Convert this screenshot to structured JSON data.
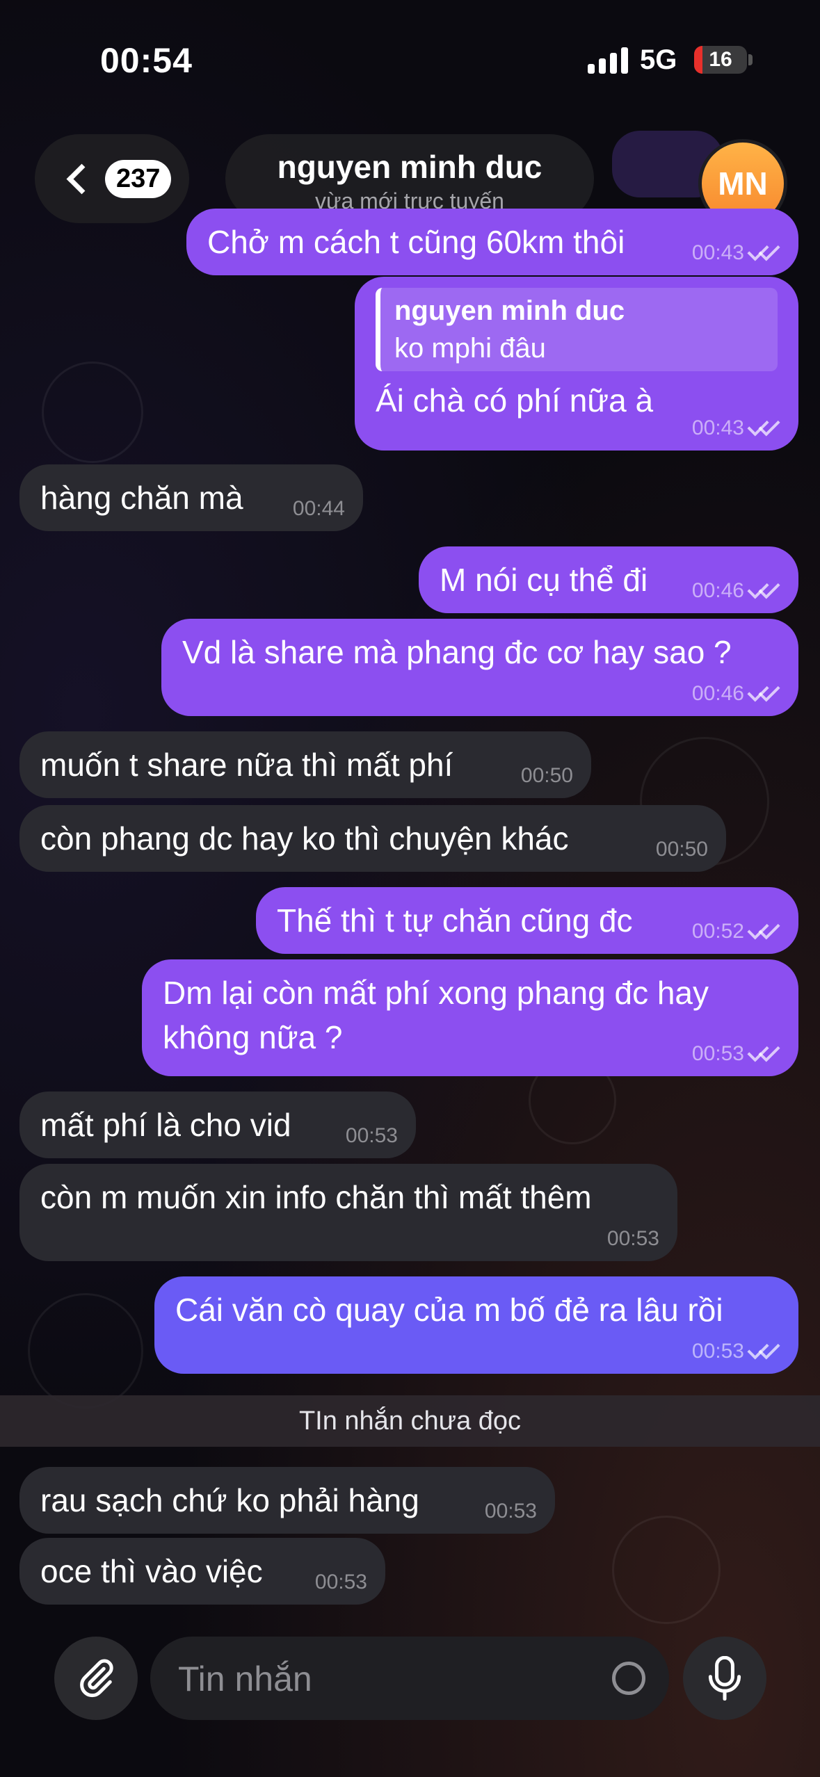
{
  "status_bar": {
    "time": "00:54",
    "network": "5G",
    "battery": "16",
    "battery_level": 0.16
  },
  "header": {
    "unread_count": "237",
    "contact_name": "nguyen minh duc",
    "contact_status": "vừa mới trực tuyến",
    "avatar_initials": "MN"
  },
  "messages": [
    {
      "dir": "out",
      "text": "Chở m cách t cũng 60km thôi",
      "time": "00:43"
    },
    {
      "dir": "out",
      "reply_name": "nguyen minh duc",
      "reply_text": "ko mphi đâu",
      "text": "Ái chà có phí nữa à",
      "time": "00:43"
    },
    {
      "dir": "in",
      "text": "hàng chăn mà",
      "time": "00:44"
    },
    {
      "dir": "out",
      "text": "M nói cụ thể đi",
      "time": "00:46"
    },
    {
      "dir": "out",
      "text": "Vd là share mà phang đc cơ hay sao ?",
      "time": "00:46"
    },
    {
      "dir": "in",
      "text": "muốn t share nữa thì mất phí",
      "time": "00:50"
    },
    {
      "dir": "in",
      "text": "còn phang dc hay ko thì chuyện khác",
      "time": "00:50"
    },
    {
      "dir": "out",
      "text": "Thế thì t tự chăn cũng đc",
      "time": "00:52"
    },
    {
      "dir": "out",
      "text": "Dm lại còn mất phí xong phang đc hay không nữa ?",
      "time": "00:53"
    },
    {
      "dir": "in",
      "text": "mất phí là cho vid",
      "time": "00:53"
    },
    {
      "dir": "in",
      "text": "còn m muốn xin info chăn thì mất thêm",
      "time": "00:53"
    },
    {
      "dir": "out",
      "text": "Cái văn cò quay của m bố đẻ ra lâu rồi",
      "time": "00:53"
    },
    {
      "dir": "in",
      "text": "rau sạch chứ ko phải hàng",
      "time": "00:53"
    },
    {
      "dir": "in",
      "text": "oce thì vào việc",
      "time": "00:53"
    }
  ],
  "unread_divider": "TIn nhắn chưa đọc",
  "composer": {
    "placeholder": "Tin nhắn",
    "attach_icon": "paperclip-icon",
    "sticker_icon": "sticker-icon",
    "mic_icon": "microphone-icon"
  },
  "colors": {
    "outgoing": "#8c4ff0",
    "outgoing_last": "#6a5bf5",
    "incoming": "#2a2a30",
    "avatar": "#f7872d"
  }
}
